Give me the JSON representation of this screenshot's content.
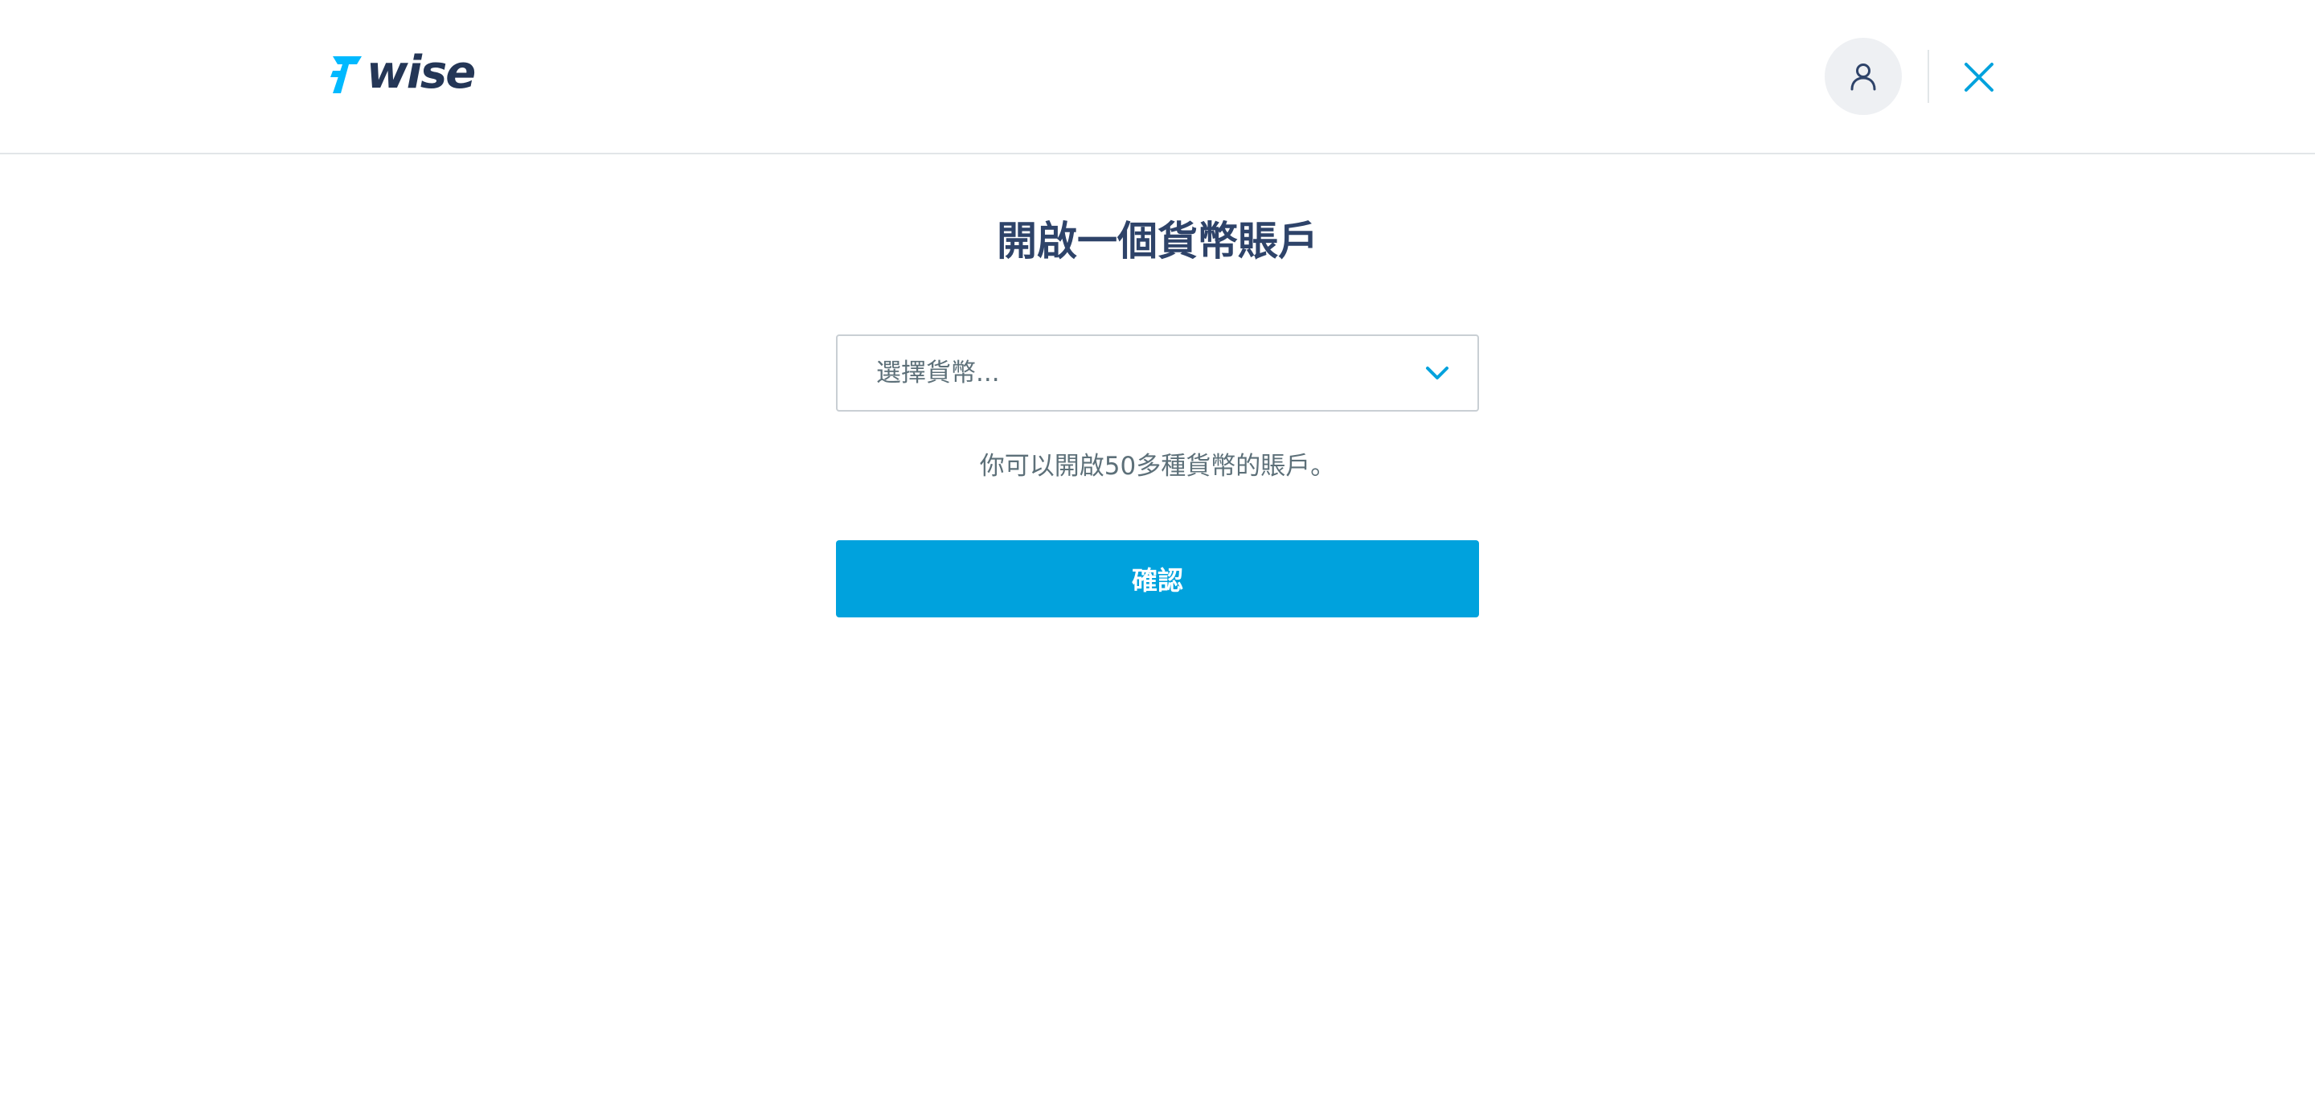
{
  "header": {
    "logo_text": "wise",
    "avatar_icon": "user-icon",
    "close_icon": "close-icon"
  },
  "main": {
    "title": "開啟一個貨幣賬戶",
    "currency_select": {
      "placeholder": "選擇貨幣...",
      "icon": "chevron-down-icon"
    },
    "helper_text": "你可以開啟50多種貨幣的賬戶。",
    "confirm_label": "確認"
  },
  "colors": {
    "brand_accent": "#00a2dd",
    "logo_flag": "#00b9ff",
    "logo_text": "#243656",
    "title": "#2e4369",
    "muted_text": "#5d7079",
    "border": "#c9cfd4",
    "avatar_bg": "#eef0f3"
  }
}
